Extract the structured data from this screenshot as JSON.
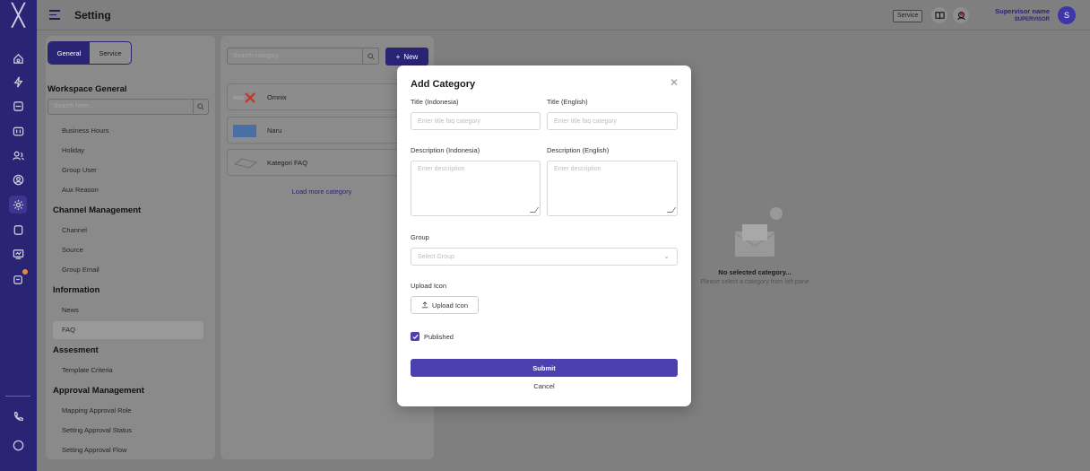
{
  "topbar": {
    "title": "Setting",
    "service_label": "Service",
    "user_name": "Supervisor name",
    "user_role": "SUPERVISOR",
    "avatar_initial": "S"
  },
  "settings_panel": {
    "tabs": [
      "General",
      "Service"
    ],
    "active_tab": "General",
    "heading": "Workspace General",
    "search_placeholder": "Search here...",
    "menu": {
      "business_hours": "Business Hours",
      "holiday": "Holiday",
      "group_user": "Group User",
      "aux_reason": "Aux Reason",
      "channel_management": "Channel Management",
      "channel": "Channel",
      "source": "Source",
      "group_email": "Group Email",
      "information": "Information",
      "news": "News",
      "faq": "FAQ",
      "assesment": "Assesment",
      "template_criteria": "Template Criteria",
      "approval_management": "Approval Management",
      "mapping_approval_role": "Mapping Approval Role",
      "setting_approval_status": "Setting Approval Status",
      "setting_approval_flow": "Setting Approval Flow"
    },
    "selected_item": "FAQ"
  },
  "category_panel": {
    "search_placeholder": "Search category",
    "new_button": "New",
    "categories": [
      {
        "name": "Omnix",
        "icon": "omnix-logo"
      },
      {
        "name": "Naru",
        "icon": "naru-logo"
      },
      {
        "name": "Kategori FAQ",
        "icon": "faq-logo"
      }
    ],
    "load_more": "Load more category"
  },
  "empty_state": {
    "title": "No selected category...",
    "subtitle": "Please select a category from left pane"
  },
  "modal": {
    "title": "Add Category",
    "title_id_label": "Title (Indonesia)",
    "title_en_label": "Title (English)",
    "title_placeholder": "Enter title faq category",
    "desc_id_label": "Description (Indonesia)",
    "desc_en_label": "Description (English)",
    "desc_placeholder": "Enter description",
    "group_label": "Group",
    "group_placeholder": "Select Group",
    "upload_label": "Upload Icon",
    "upload_button": "Upload Icon",
    "published_label": "Published",
    "published": true,
    "submit": "Submit",
    "cancel": "Cancel"
  },
  "colors": {
    "brand": "#2a2474",
    "primary_button": "#4c3fb0",
    "overlay": "#7f7f7f"
  }
}
